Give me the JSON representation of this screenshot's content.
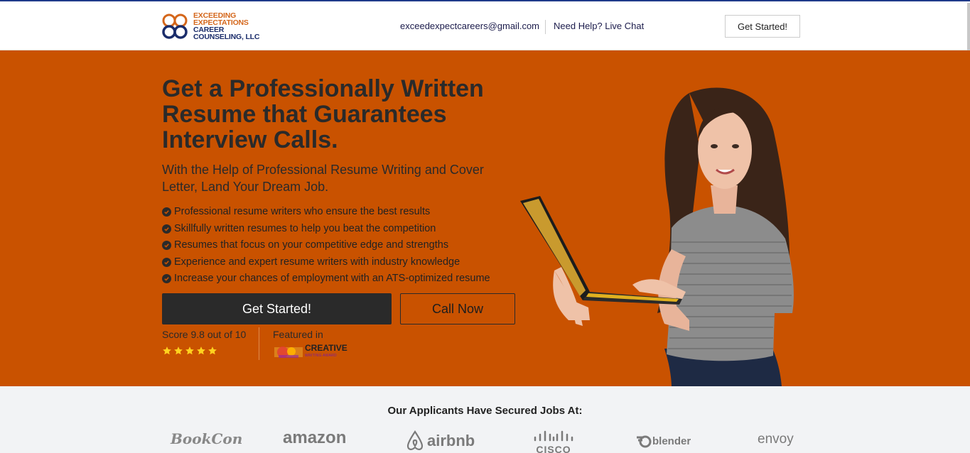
{
  "header": {
    "logo_lines": [
      "EXCEEDING",
      "EXPECTATIONS",
      "CAREER",
      "COUNSELING, LLC"
    ],
    "email": "exceedexpectcareers@gmail.com",
    "live_chat": "Need Help? Live Chat",
    "cta_label": "Get Started!"
  },
  "hero": {
    "title": "Get a Professionally Written Resume that Guarantees Interview Calls.",
    "subtitle": "With the Help of Professional Resume Writing and Cover Letter, Land Your Dream Job.",
    "bullets": [
      "Professional resume writers who ensure the best results",
      "Skillfully written resumes to help you beat the competition",
      "Resumes that focus on your competitive edge and strengths",
      "Experience and expert resume writers with industry knowledge",
      "Increase your chances of employment with an ATS-optimized resume"
    ],
    "primary_button": "Get Started!",
    "secondary_button": "Call Now",
    "score_text": "Score 9.8 out of 10",
    "stars": 5,
    "featured_text": "Featured in",
    "featured_logo": "CREATIVE",
    "featured_logo_sub": "WRITING AWARD",
    "background_color": "#c95200"
  },
  "band": {
    "title": "Our Applicants Have Secured Jobs At:",
    "brands": [
      "BookCon",
      "amazon",
      "airbnb",
      "CISCO",
      "blender",
      "envoy"
    ]
  },
  "icons": {
    "check": "check-circle-icon",
    "star": "star-icon"
  }
}
